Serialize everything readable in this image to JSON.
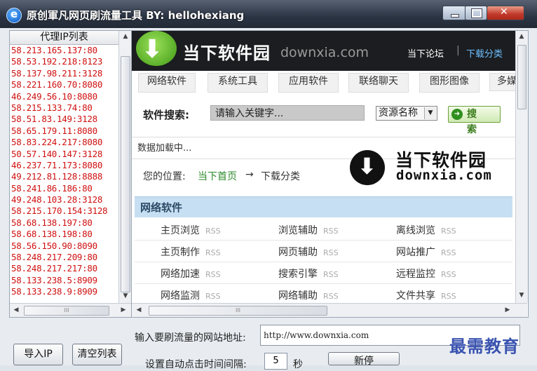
{
  "window": {
    "title": "原创軍凡网页刷流量工具 BY: hellohexiang"
  },
  "proxy": {
    "header": "代理IP列表",
    "items": [
      "58.213.165.137:80",
      "58.53.192.218:8123",
      "58.137.98.211:3128",
      "58.221.160.70:8080",
      "46.249.56.10:8080",
      "58.215.133.74:80",
      "58.51.83.149:3128",
      "58.65.179.11:8080",
      "58.83.224.217:8080",
      "50.57.140.147:3128",
      "46.237.71.173:8080",
      "49.212.81.128:8888",
      "58.241.86.186:80",
      "49.248.103.28:3128",
      "58.215.170.154:3128",
      "58.68.138.197:80",
      "58.68.138.198:80",
      "58.56.150.90:8090",
      "58.248.217.209:80",
      "58.248.217.217:80",
      "58.133.238.5:8909",
      "58.133.238.9:8909"
    ],
    "hscroll_grip": "III"
  },
  "site": {
    "name": "当下软件园",
    "domain": "downxia.com",
    "top_links": [
      "当下论坛",
      "下载分类"
    ],
    "top_sep": "|",
    "nav_tabs": [
      "网络软件",
      "系统工具",
      "应用软件",
      "联络聊天",
      "图形图像",
      "多媒"
    ],
    "search": {
      "label": "软件搜索:",
      "placeholder": "请输入关键字...",
      "select_value": "资源名称",
      "button": "搜 索"
    },
    "loading": "数据加载中...",
    "location": {
      "label": "您的位置:",
      "home": "当下首页",
      "arrow": "→",
      "current": "下载分类"
    },
    "watermark": {
      "title": "当下软件园",
      "domain": "downxia.com"
    },
    "category": {
      "title": "网络软件",
      "rss": "RSS",
      "rows": [
        [
          "主页浏览",
          "浏览辅助",
          "离线浏览"
        ],
        [
          "主页制作",
          "网页辅助",
          "网站推广"
        ],
        [
          "网络加速",
          "搜索引擎",
          "远程监控"
        ],
        [
          "网络监测",
          "网络辅助",
          "文件共享"
        ]
      ]
    },
    "hscroll_grip": "III"
  },
  "form": {
    "url_label": "输入要刷流量的网站地址:",
    "url_value": "http://www.downxia.com",
    "timer_label": "设置自动点击时间间隔:",
    "timer_value": "5",
    "timer_unit": "秒",
    "import_button": "导入IP",
    "clear_button": "清空列表",
    "refresh_button": "新停"
  },
  "watermark_bottom": "最需教育"
}
